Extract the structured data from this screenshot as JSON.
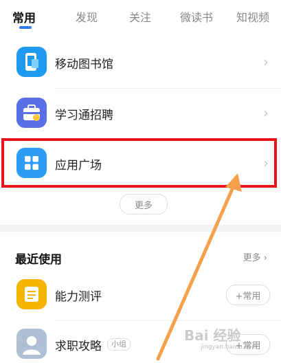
{
  "tabs": [
    {
      "label": "常用",
      "active": true
    },
    {
      "label": "发现"
    },
    {
      "label": "关注"
    },
    {
      "label": "微读书"
    },
    {
      "label": "知视频"
    }
  ],
  "common_items": [
    {
      "label": "移动图书馆",
      "icon": "mobile-library-icon",
      "color": "#1e9bf0"
    },
    {
      "label": "学习通招聘",
      "icon": "briefcase-icon",
      "color": "#5a6ee8"
    },
    {
      "label": "应用广场",
      "icon": "app-grid-icon",
      "color": "#2c9cf5"
    }
  ],
  "more_label": "更多",
  "recent": {
    "title": "最近使用",
    "more_label": "更多",
    "items": [
      {
        "label": "能力测评",
        "icon": "assessment-icon",
        "color": "#f4b400",
        "action": "+常用"
      },
      {
        "label": "求职攻略",
        "icon": "user-avatar-icon",
        "color": "#aebfd6",
        "tag": "小组",
        "action": "+常用"
      }
    ]
  },
  "watermark": {
    "text": "Bai 经验",
    "sub": "jingyan.baidu.com"
  },
  "colors": {
    "accent": "#2f7bf5",
    "highlight": "#e8141b",
    "arrow": "#f5a04a"
  }
}
